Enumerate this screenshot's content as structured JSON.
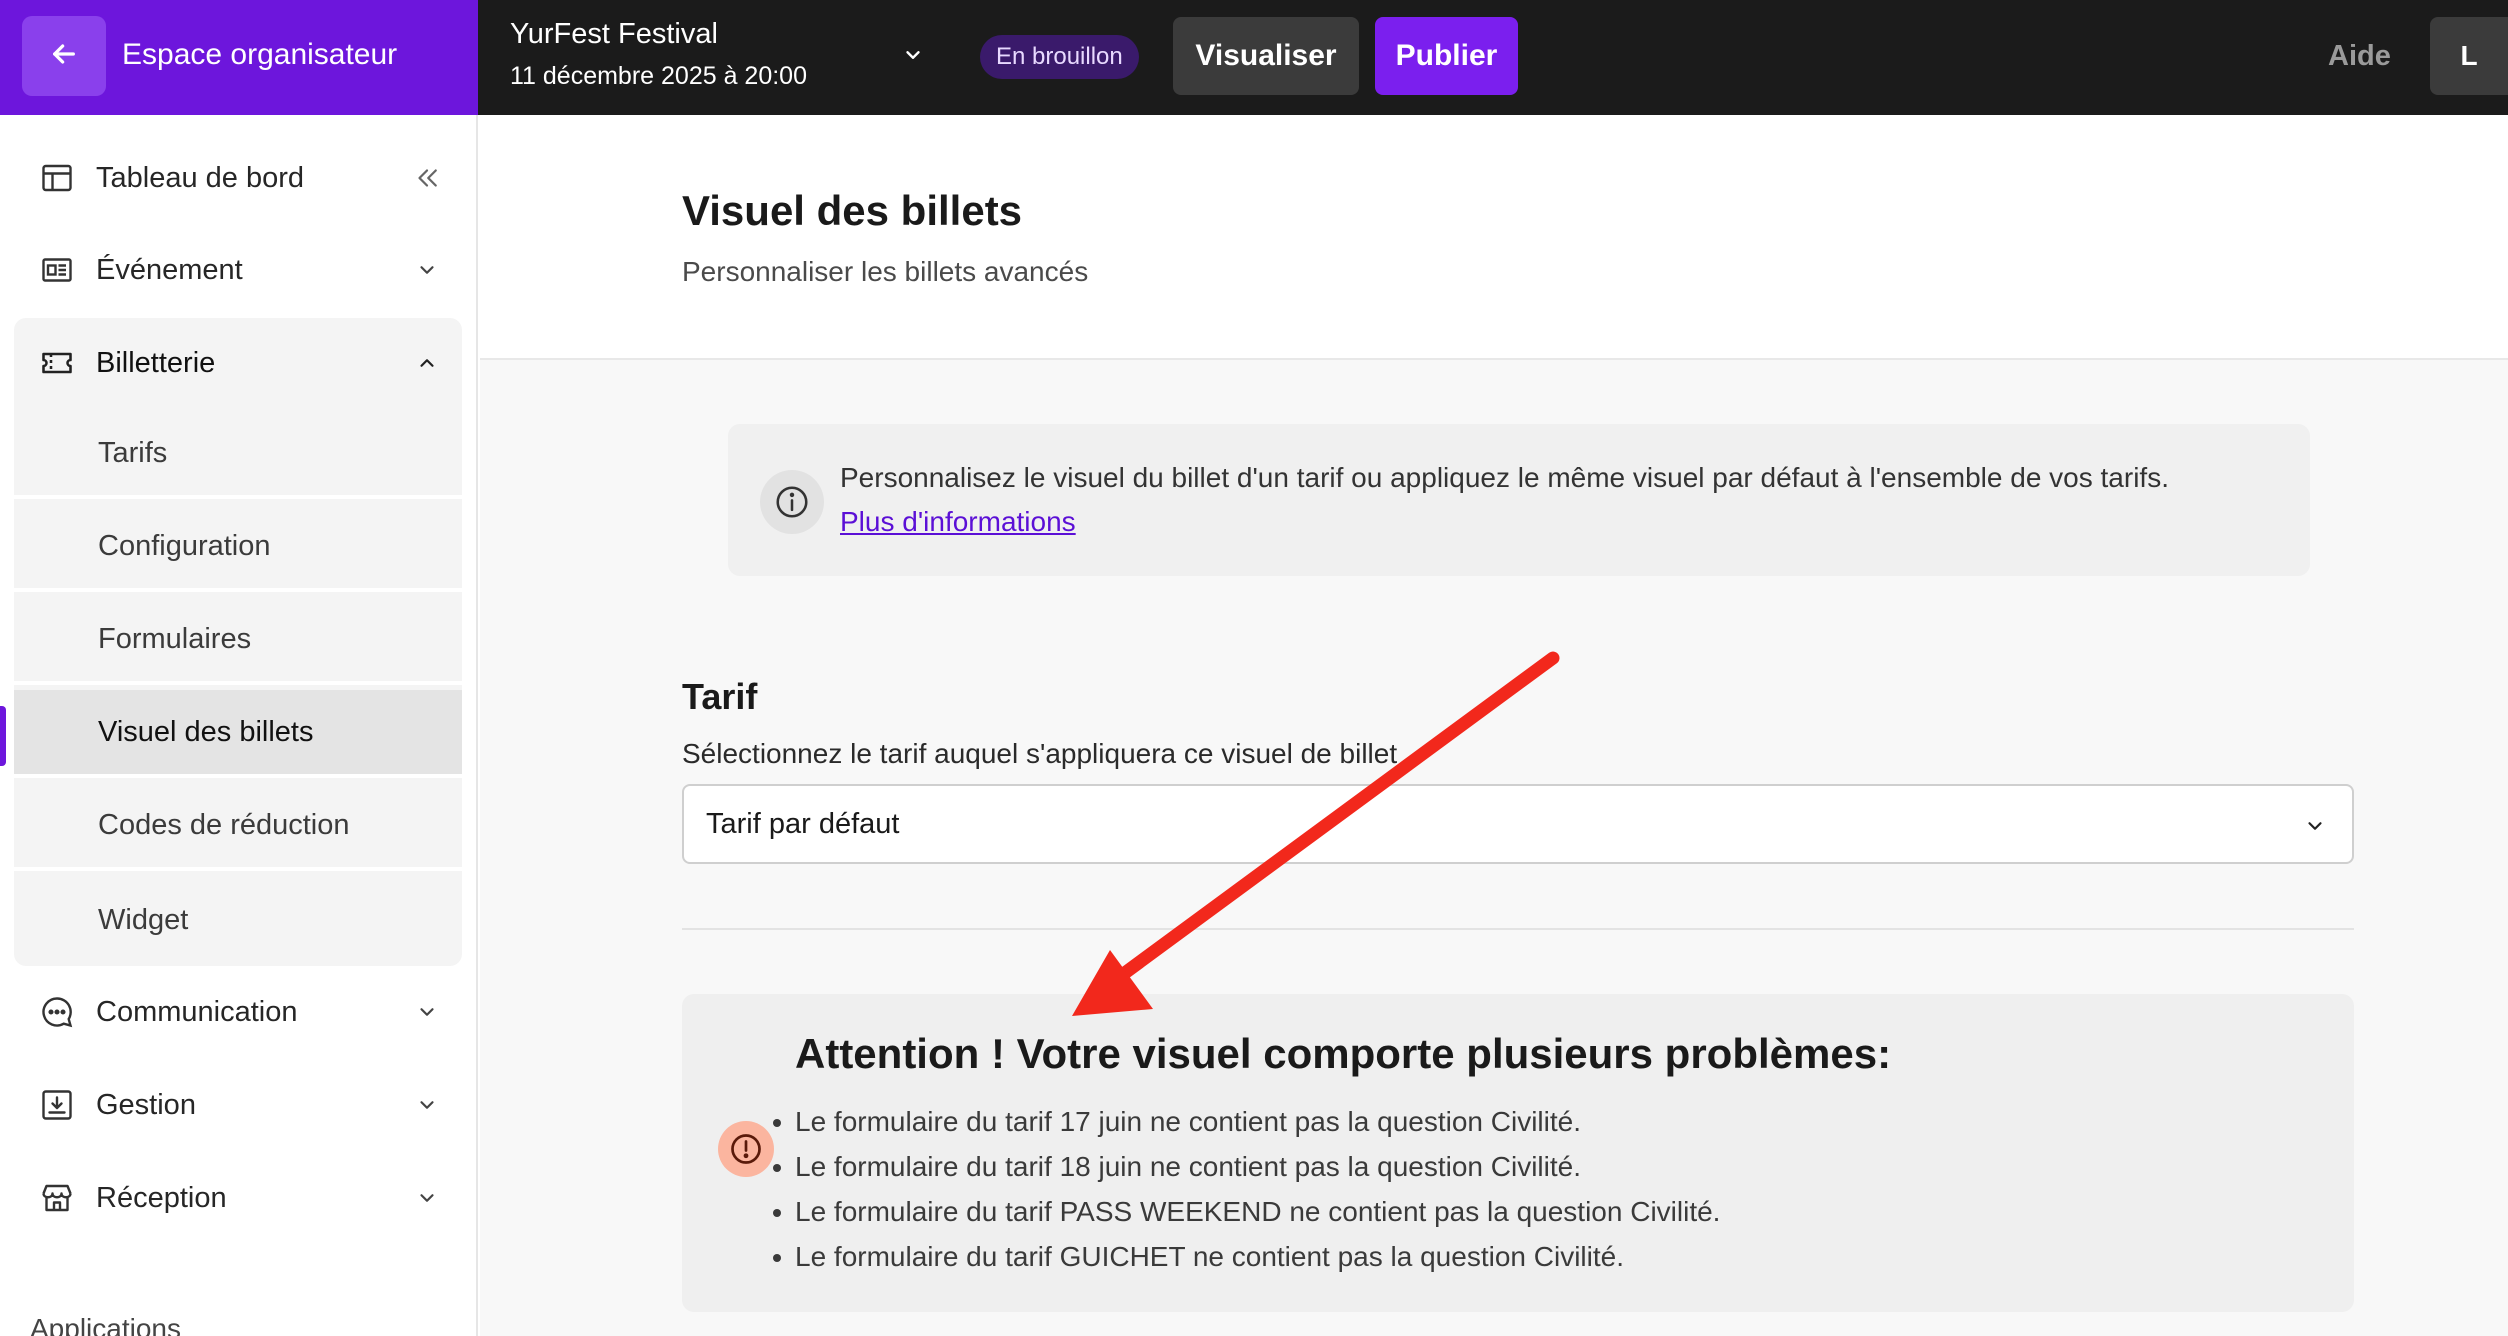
{
  "topbar": {
    "org_label": "Espace organisateur",
    "event_name": "YurFest Festival",
    "event_date": "11 décembre 2025 à 20:00",
    "status_badge": "En brouillon",
    "preview_label": "Visualiser",
    "publish_label": "Publier",
    "help_label": "Aide",
    "avatar_initial": "L"
  },
  "sidebar": {
    "items": [
      {
        "label": "Tableau de bord",
        "icon": "layout-dashboard-icon"
      },
      {
        "label": "Événement",
        "icon": "newspaper-icon"
      },
      {
        "label": "Billetterie",
        "icon": "ticket-icon"
      },
      {
        "label": "Communication",
        "icon": "chat-bubble-icon"
      },
      {
        "label": "Gestion",
        "icon": "download-tray-icon"
      },
      {
        "label": "Réception",
        "icon": "store-icon"
      }
    ],
    "billetterie_sub": [
      "Tarifs",
      "Configuration",
      "Formulaires",
      "Visuel des billets",
      "Codes de réduction",
      "Widget"
    ],
    "active_sub": "Visuel des billets",
    "apps_label": "Applications"
  },
  "page": {
    "title": "Visuel des billets",
    "subtitle": "Personnaliser les billets avancés"
  },
  "info": {
    "text": "Personnalisez le visuel du billet d'un tarif ou appliquez le même visuel par défaut à l'ensemble de vos tarifs.",
    "link": "Plus d'informations"
  },
  "tarif": {
    "title": "Tarif",
    "description": "Sélectionnez le tarif auquel s'appliquera ce visuel de billet",
    "selected": "Tarif par défaut"
  },
  "warning": {
    "title": "Attention ! Votre visuel comporte plusieurs problèmes:",
    "items": [
      "Le formulaire du tarif 17 juin ne contient pas la question Civilité.",
      "Le formulaire du tarif 18 juin ne contient pas la question Civilité.",
      "Le formulaire du tarif PASS WEEKEND ne contient pas la question Civilité.",
      "Le formulaire du tarif GUICHET ne contient pas la question Civilité."
    ]
  },
  "colors": {
    "brand": "#6d16dc",
    "topbar": "#1b1b1b",
    "annotation_arrow": "#f2281c",
    "warning_icon_bg": "#fbb59f"
  }
}
